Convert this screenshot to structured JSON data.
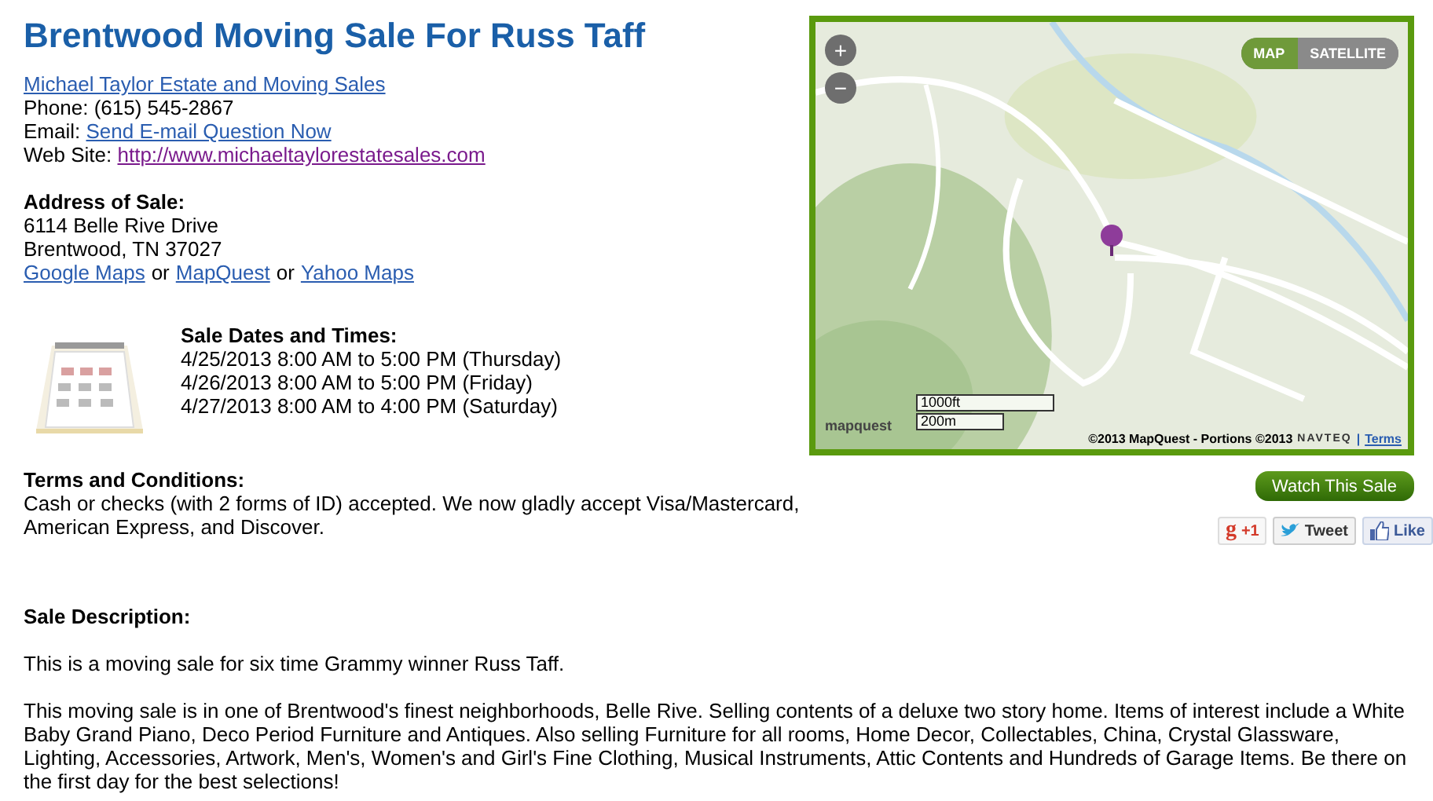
{
  "title": "Brentwood Moving Sale For Russ Taff",
  "contact": {
    "company": "Michael Taylor Estate and Moving Sales",
    "phone_label": "Phone:",
    "phone": "(615) 545-2867",
    "email_label": "Email:",
    "email_link": "Send E-mail Question Now",
    "site_label": "Web Site:",
    "site_link": "http://www.michaeltaylorestatesales.com"
  },
  "address": {
    "heading": "Address of Sale:",
    "lines": [
      "6114 Belle Rive Drive",
      "Brentwood, TN 37027"
    ],
    "map_links": [
      {
        "label": "Google Maps",
        "sep": "or"
      },
      {
        "label": "MapQuest",
        "sep": "or"
      },
      {
        "label": "Yahoo Maps"
      }
    ]
  },
  "dates": {
    "heading": "Sale Dates and Times:",
    "lines": [
      "4/25/2013 8:00 AM to 5:00 PM (Thursday)",
      "4/26/2013 8:00 AM to 5:00 PM (Friday)",
      "4/27/2013 8:00 AM to 4:00 PM (Saturday)"
    ]
  },
  "terms": {
    "heading": "Terms and Conditions:",
    "text": "Cash or checks (with 2 forms of ID) accepted. We now gladly accept Visa/Mastercard, American Express, and Discover."
  },
  "map": {
    "zoom_in": "+",
    "zoom_out": "−",
    "modes": [
      {
        "label": "MAP",
        "selected": true
      },
      {
        "label": "SATELLITE",
        "selected": false
      }
    ],
    "scale": [
      "1000ft",
      "200m"
    ],
    "logo": "mapquest",
    "copyright": "©2013 MapQuest  -  Portions ©2013",
    "provider": "NAVTEQ",
    "divider": "|",
    "terms_link": "Terms"
  },
  "watch_button": "Watch This Sale",
  "social": {
    "gplus_logo": "g",
    "gplus": "+1",
    "tweet": "Tweet",
    "like": "Like"
  },
  "description": {
    "heading": "Sale Description:",
    "paragraphs": [
      "This is a moving sale for six time Grammy winner Russ Taff.",
      "This moving sale is in one of Brentwood's finest neighborhoods, Belle Rive.  Selling contents of a deluxe two story home.  Items of interest include a White Baby Grand Piano, Deco Period Furniture and Antiques.  Also selling Furniture for all rooms, Home Decor, Collectables, China, Crystal Glassware, Lighting, Accessories, Artwork, Men's, Women's and Girl's Fine Clothing, Musical Instruments, Attic Contents and Hundreds of Garage Items.  Be there on the first day for the best selections!"
    ]
  }
}
